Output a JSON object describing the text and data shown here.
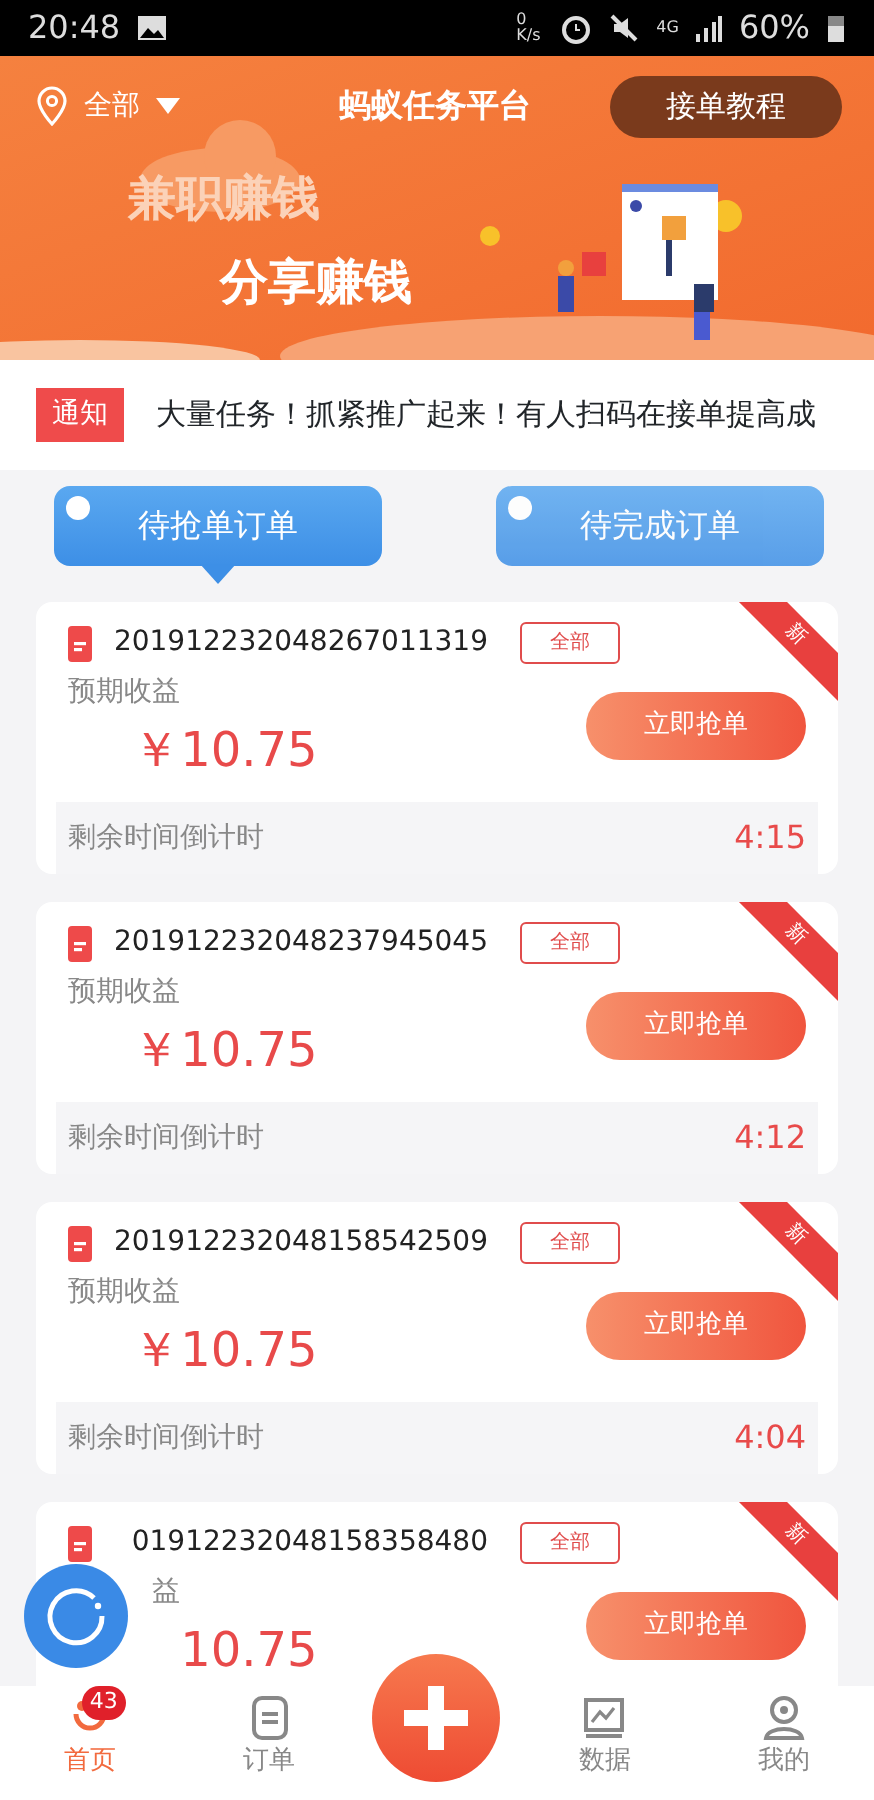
{
  "status_bar": {
    "time": "20:48",
    "speed": "0 K/s",
    "network": "4G",
    "battery": "60%"
  },
  "header": {
    "location": "全部",
    "title": "蚂蚁任务平台",
    "tutorial_button": "接单教程",
    "slogans": [
      "兼职赚钱",
      "分享赚钱"
    ]
  },
  "notice": {
    "badge": "通知",
    "text": "大量任务！抓紧推广起来！有人扫码在接单提高成"
  },
  "tabs": [
    {
      "label": "待抢单订单",
      "selected": true
    },
    {
      "label": "待完成订单",
      "selected": false
    }
  ],
  "orders": [
    {
      "id": "201912232048267011319",
      "tag": "全部",
      "earnings_label": "预期收益",
      "price": "￥10.75",
      "button": "立即抢单",
      "countdown_label": "剩余时间倒计时",
      "countdown": "4:15",
      "ribbon": "新"
    },
    {
      "id": "201912232048237945045",
      "tag": "全部",
      "earnings_label": "预期收益",
      "price": "￥10.75",
      "button": "立即抢单",
      "countdown_label": "剩余时间倒计时",
      "countdown": "4:12",
      "ribbon": "新"
    },
    {
      "id": "201912232048158542509",
      "tag": "全部",
      "earnings_label": "预期收益",
      "price": "￥10.75",
      "button": "立即抢单",
      "countdown_label": "剩余时间倒计时",
      "countdown": "4:04",
      "ribbon": "新"
    },
    {
      "id": "01912232048158358480",
      "tag": "全部",
      "earnings_label": "益",
      "price": "10.75",
      "button": "立即抢单",
      "ribbon": "新"
    }
  ],
  "bottom_nav": [
    {
      "label": "首页",
      "selected": true,
      "badge": "43",
      "kind": "home"
    },
    {
      "label": "订单",
      "selected": false,
      "kind": "orders"
    },
    {
      "kind": "add",
      "selected": false
    },
    {
      "label": "数据",
      "selected": false,
      "kind": "data"
    },
    {
      "label": "我的",
      "selected": false,
      "kind": "profile"
    }
  ]
}
